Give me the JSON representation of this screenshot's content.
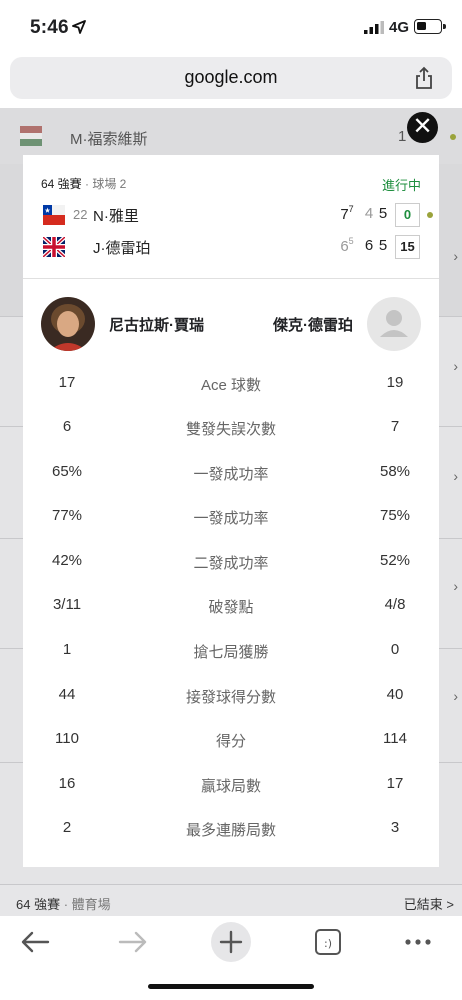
{
  "status_bar": {
    "time": "5:46",
    "network": "4G"
  },
  "browser": {
    "url": "google.com"
  },
  "background": {
    "top_row": {
      "name": "M·福索維斯",
      "score": "1"
    },
    "footer": {
      "round": "64 強賽",
      "separator": " · ",
      "venue": "體育場",
      "status": "已結束 >"
    }
  },
  "match": {
    "round": "64 強賽",
    "court": " · 球場 2",
    "status": "進行中",
    "player1": {
      "seed": "22",
      "name": "N·雅里",
      "sets": [
        "7",
        "4",
        "5"
      ],
      "tb": "7",
      "points": "0"
    },
    "player2": {
      "seed": "",
      "name": "J·德雷珀",
      "sets": [
        "6",
        "6",
        "5"
      ],
      "tb": "5",
      "points": "15"
    }
  },
  "players": {
    "left_name": "尼古拉斯·賈瑞",
    "right_name": "傑克·德雷珀"
  },
  "stats": [
    {
      "label": "Ace 球數",
      "left": "17",
      "right": "19"
    },
    {
      "label": "雙發失誤次數",
      "left": "6",
      "right": "7"
    },
    {
      "label": "一發成功率",
      "left": "65%",
      "right": "58%"
    },
    {
      "label": "一發成功率",
      "left": "77%",
      "right": "75%"
    },
    {
      "label": "二發成功率",
      "left": "42%",
      "right": "52%"
    },
    {
      "label": "破發點",
      "left": "3/11",
      "right": "4/8"
    },
    {
      "label": "搶七局獲勝",
      "left": "1",
      "right": "0"
    },
    {
      "label": "接發球得分數",
      "left": "44",
      "right": "40"
    },
    {
      "label": "得分",
      "left": "110",
      "right": "114"
    },
    {
      "label": "贏球局數",
      "left": "16",
      "right": "17"
    },
    {
      "label": "最多連勝局數",
      "left": "2",
      "right": "3"
    }
  ],
  "colors": {
    "live_green": "#1e8e3e",
    "serve_dot": "#9aa33b"
  },
  "icons": [
    "location-arrow-icon",
    "signal-icon",
    "battery-icon",
    "share-icon",
    "close-icon",
    "back-icon",
    "forward-icon",
    "new-tab-icon",
    "tabs-icon",
    "more-icon"
  ]
}
